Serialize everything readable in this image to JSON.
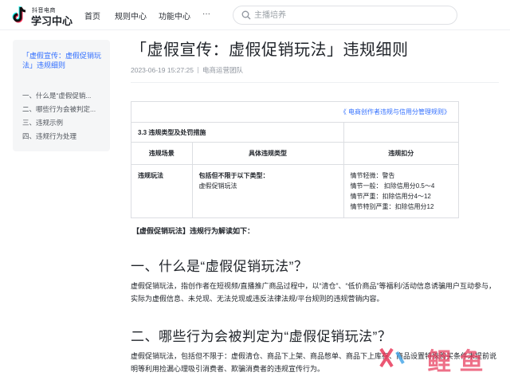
{
  "header": {
    "logo_sub": "抖音电商",
    "logo_main": "学习中心",
    "nav": [
      "首页",
      "规则中心",
      "功能中心",
      "···"
    ],
    "search_placeholder": "主播培养"
  },
  "toc": {
    "title": "「虚假宣传：虚假促销玩法」违规细则",
    "items": [
      "一、什么是“虚假促销...",
      "二、哪些行为会被判定...",
      "三、违规示例",
      "四、违规行为处理"
    ]
  },
  "article": {
    "title": "「虚假宣传：虚假促销玩法」违规细则",
    "date": "2023-06-19 15:27:25",
    "author": "电商运营团队",
    "rule_link": "《 电商创作者违规与信用分管理规则》",
    "section": "3.3 违规类型及处罚措施",
    "headers": [
      "违规场景",
      "具体违规类型",
      "违规扣分"
    ],
    "row": {
      "scene": "违规玩法",
      "type_title": "包括但不限于以下类型：",
      "type_item": "虚假促销玩法",
      "penalties": [
        "情节轻微：警告",
        "情节一般： 扣除信用分0.5～4",
        "情节严重：扣除信用分4～12",
        "情节特别严重：扣除信用分12"
      ]
    },
    "lead": "【虚假促销玩法】违规行为解读如下：",
    "h2_1": "一、什么是“虚假促销玩法”？",
    "p1": "虚假促销玩法，指创作者在短视频/直播推广商品过程中，以“清仓”、“低价商品”等福利/活动信息诱骗用户互动参与，实际为虚假信息、未兑现、无法兑现或违反法律法规/平台规则的违规营销内容。",
    "h2_2": "二、哪些行为会被判定为“虚假促销玩法”？",
    "p2": "虚假促销玩法，包括但不限于：虚假清仓、商品下上架、商品憋单、商品下上库存、商品设置特殊购买条件未提前说明等利用捡漏心理吸引消费者、欺骗消费者的违规宣传行为。"
  },
  "watermark": "鲤 鱼"
}
